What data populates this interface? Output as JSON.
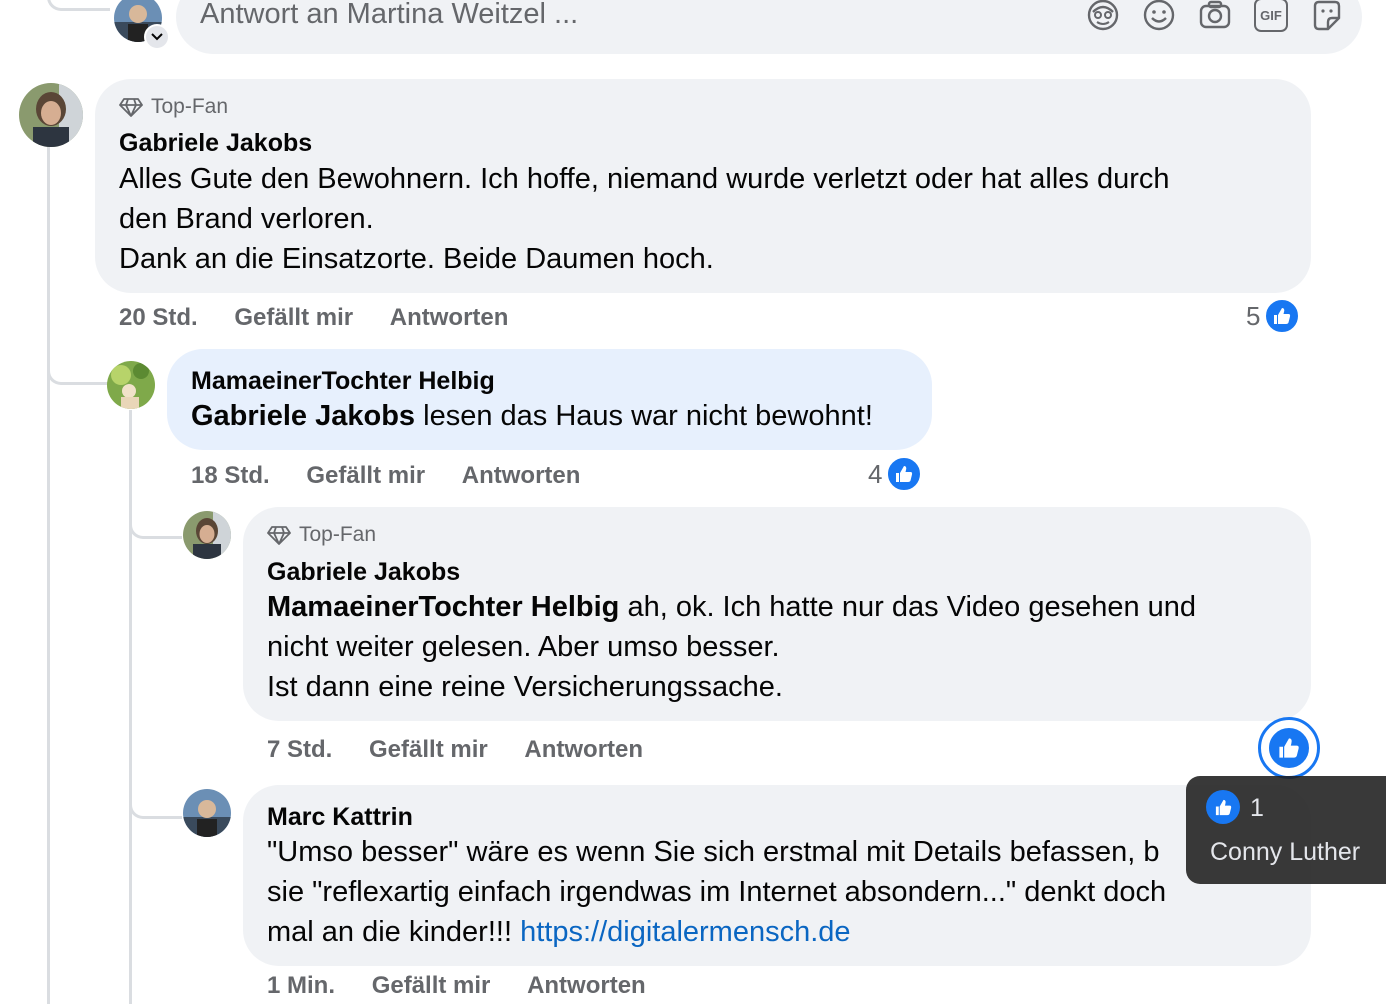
{
  "reply_input": {
    "placeholder": "Antwort an Martina Weitzel ..."
  },
  "toolbar_icons": [
    "avatar-sticker-icon",
    "emoji-icon",
    "camera-icon",
    "gif-icon",
    "sticker-icon"
  ],
  "gif_label": "GIF",
  "colors": {
    "accent": "#1877f2",
    "bubble": "#f0f2f5",
    "bubble_highlight": "#e7f0fd",
    "meta": "#65676b",
    "link": "#0a66c2"
  },
  "comments": [
    {
      "badge": "Top-Fan",
      "author": "Gabriele Jakobs",
      "lines": [
        "Alles Gute den Bewohnern. Ich hoffe, niemand wurde verletzt oder hat alles durch",
        "den Brand verloren.",
        "Dank an die Einsatzorte. Beide Daumen hoch."
      ],
      "time": "20 Std.",
      "like": "Gefällt mir",
      "reply": "Antworten",
      "reactions": "5"
    },
    {
      "author": "MamaeinerTochter Helbig",
      "mention": "Gabriele Jakobs",
      "text": " lesen das Haus war nicht bewohnt!",
      "time": "18 Std.",
      "like": "Gefällt mir",
      "reply": "Antworten",
      "reactions": "4"
    },
    {
      "badge": "Top-Fan",
      "author": "Gabriele Jakobs",
      "mention": "MamaeinerTochter Helbig",
      "line1_rest": " ah, ok. Ich hatte nur das Video gesehen und",
      "line2": "nicht weiter gelesen. Aber umso besser.",
      "line3": "Ist dann eine reine Versicherungssache.",
      "time": "7 Std.",
      "like": "Gefällt mir",
      "reply": "Antworten"
    },
    {
      "author": "Marc Kattrin",
      "line1": "\"Umso besser\" wäre es wenn Sie sich erstmal mit Details befassen, b",
      "line2": "sie \"reflexartig einfach irgendwas im Internet absondern...\" denkt doch",
      "line3_text": "mal an die kinder!!! ",
      "link": "https://digitalermensch.de",
      "time": "1 Min.",
      "like": "Gefällt mir",
      "reply": "Antworten"
    }
  ],
  "tooltip": {
    "count": "1",
    "name": "Conny Luther"
  }
}
